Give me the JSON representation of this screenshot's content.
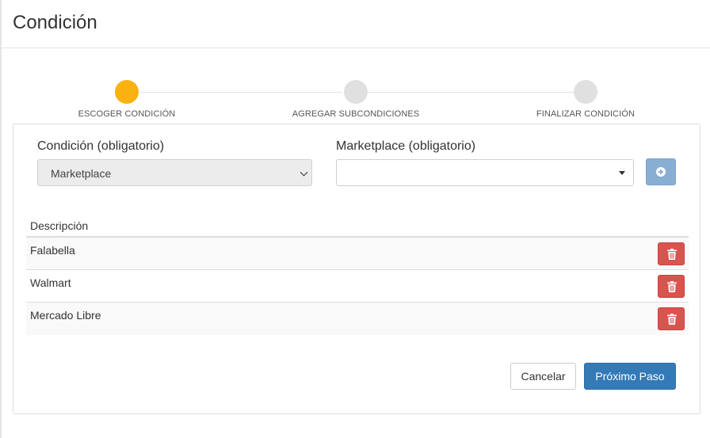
{
  "header": {
    "title": "Condición"
  },
  "stepper": {
    "steps": [
      {
        "label": "ESCOGER CONDICIÓN",
        "active": true
      },
      {
        "label": "AGREGAR SUBCONDICIONES",
        "active": false
      },
      {
        "label": "FINALIZAR CONDICIÓN",
        "active": false
      }
    ],
    "active_color": "#fbb110",
    "inactive_color": "#e0e0e0"
  },
  "form": {
    "condition_label": "Condición (obligatorio)",
    "condition_value": "Marketplace",
    "marketplace_label": "Marketplace (obligatorio)",
    "marketplace_value": "",
    "add_icon": "plus-circle-icon"
  },
  "table": {
    "header": "Descripción",
    "rows": [
      {
        "description": "Falabella"
      },
      {
        "description": "Walmart"
      },
      {
        "description": "Mercado Libre"
      }
    ],
    "delete_icon": "trash-icon"
  },
  "footer": {
    "cancel_label": "Cancelar",
    "next_label": "Próximo Paso"
  },
  "colors": {
    "primary": "#337ab7",
    "danger": "#d9534f",
    "add_button": "#89aed4"
  }
}
